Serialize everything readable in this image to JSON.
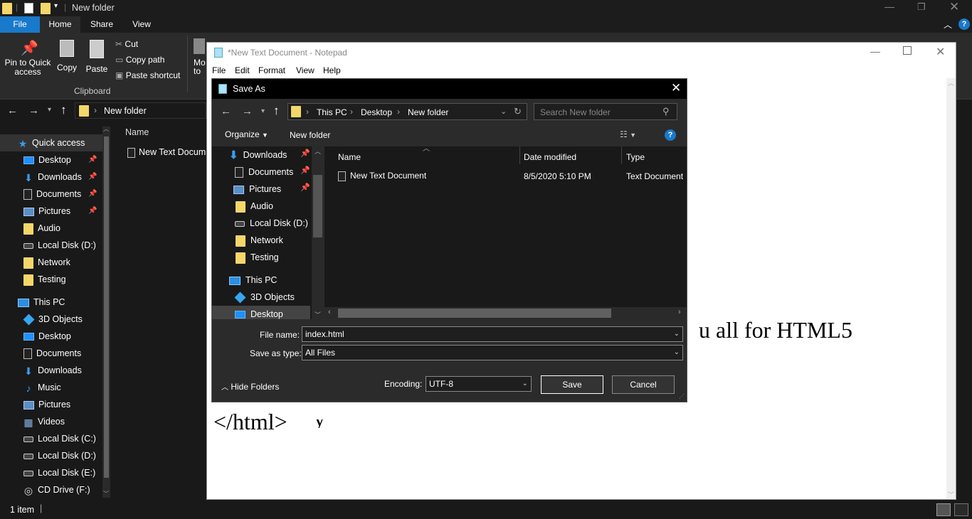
{
  "explorer": {
    "title": "New folder",
    "tabs": {
      "file": "File",
      "home": "Home",
      "share": "Share",
      "view": "View"
    },
    "ribbon": {
      "pin": "Pin to Quick access",
      "copy": "Copy",
      "paste": "Paste",
      "cut": "Cut",
      "copy_path": "Copy path",
      "paste_shortcut": "Paste shortcut",
      "group": "Clipboard",
      "move": "Mo to"
    },
    "address": "New folder",
    "column_name": "Name",
    "file": "New Text Docum",
    "sidebar": [
      {
        "label": "Quick access",
        "icon": "star-icon"
      },
      {
        "label": "Desktop",
        "icon": "desktop-icon",
        "pinned": true
      },
      {
        "label": "Downloads",
        "icon": "downloads-icon",
        "pinned": true
      },
      {
        "label": "Documents",
        "icon": "documents-icon",
        "pinned": true
      },
      {
        "label": "Pictures",
        "icon": "pictures-icon",
        "pinned": true
      },
      {
        "label": "Audio",
        "icon": "folder-icon"
      },
      {
        "label": "Local Disk (D:)",
        "icon": "drive-icon"
      },
      {
        "label": "Network",
        "icon": "folder-icon"
      },
      {
        "label": "Testing",
        "icon": "folder-icon"
      },
      {
        "label": "This PC",
        "icon": "pc-icon"
      },
      {
        "label": "3D Objects",
        "icon": "objects-icon"
      },
      {
        "label": "Desktop",
        "icon": "desktop-icon"
      },
      {
        "label": "Documents",
        "icon": "documents-icon"
      },
      {
        "label": "Downloads",
        "icon": "downloads-icon"
      },
      {
        "label": "Music",
        "icon": "music-icon"
      },
      {
        "label": "Pictures",
        "icon": "pictures-icon"
      },
      {
        "label": "Videos",
        "icon": "videos-icon"
      },
      {
        "label": "Local Disk (C:)",
        "icon": "drive-icon"
      },
      {
        "label": "Local Disk (D:)",
        "icon": "drive-icon"
      },
      {
        "label": "Local Disk (E:)",
        "icon": "drive-icon"
      },
      {
        "label": "CD Drive (F:)",
        "icon": "cd-icon"
      }
    ],
    "status": "1 item"
  },
  "notepad": {
    "title": "*New Text Document - Notepad",
    "menu": [
      "File",
      "Edit",
      "Format",
      "View",
      "Help"
    ],
    "line1": "u all for HTML5",
    "line2": "y",
    "line3": "</html>"
  },
  "dialog": {
    "title": "Save As",
    "breadcrumb": [
      "This PC",
      "Desktop",
      "New folder"
    ],
    "search_placeholder": "Search New folder",
    "organize": "Organize",
    "new_folder": "New folder",
    "nav": [
      {
        "label": "Downloads",
        "pinned": true
      },
      {
        "label": "Documents",
        "pinned": true
      },
      {
        "label": "Pictures",
        "pinned": true
      },
      {
        "label": "Audio"
      },
      {
        "label": "Local Disk (D:)"
      },
      {
        "label": "Network"
      },
      {
        "label": "Testing"
      },
      {
        "label": "This PC"
      },
      {
        "label": "3D Objects"
      },
      {
        "label": "Desktop",
        "selected": true
      }
    ],
    "columns": {
      "name": "Name",
      "date": "Date modified",
      "type": "Type"
    },
    "files": [
      {
        "name": "New Text Document",
        "date": "8/5/2020 5:10 PM",
        "type": "Text Document"
      }
    ],
    "file_name_label": "File name:",
    "file_name": "index.html",
    "save_type_label": "Save as type:",
    "save_type": "All Files",
    "hide_folders": "Hide Folders",
    "encoding_label": "Encoding:",
    "encoding": "UTF-8",
    "save": "Save",
    "cancel": "Cancel"
  }
}
